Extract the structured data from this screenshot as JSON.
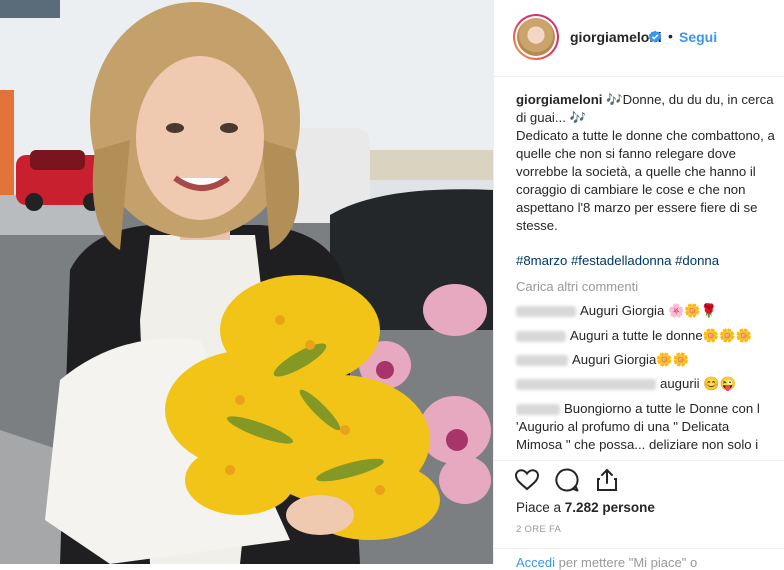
{
  "post": {
    "username": "giorgiameloni",
    "follow_label": "Segui",
    "dot": "•",
    "caption_user": "giorgiameloni",
    "caption_note1": "🎶",
    "caption_line1": "Donne, du du du, in cerca di guai...",
    "caption_note2": "🎶",
    "caption_body": "Dedicato a tutte le donne che combattono, a quelle che non si fanno relegare dove vorrebbe la società, a quelle che hanno il coraggio di cambiare le cose e che non aspettano l'8 marzo per essere fiere di se stesse.",
    "hashtags": "#8marzo #festadelladonna #donna",
    "load_more": "Carica altri commenti",
    "comments": [
      {
        "text": "Auguri Giorgia 🌸🌼🌹"
      },
      {
        "text": "Auguri a tutte le donne🌼🌼🌼"
      },
      {
        "text": "Auguri Giorgia🌼🌼"
      },
      {
        "text": "augurii 😊😜"
      },
      {
        "text": "Buongiorno a tutte le Donne con l 'Augurio al profumo di una \" Delicata Mimosa \" che possa... deliziare non solo i"
      }
    ],
    "likes_prefix": "Piace a",
    "likes_count": "7.282 persone",
    "time_ago": "2 ORE FA",
    "login_link": "Accedi",
    "login_text": "per mettere \"Mi piace\" o"
  },
  "icons": [
    "verified-badge-icon",
    "heart-icon",
    "comment-icon",
    "share-icon"
  ],
  "colors": {
    "link": "#3897f0",
    "hashtag": "#003569",
    "muted": "#999999",
    "text": "#262626"
  }
}
